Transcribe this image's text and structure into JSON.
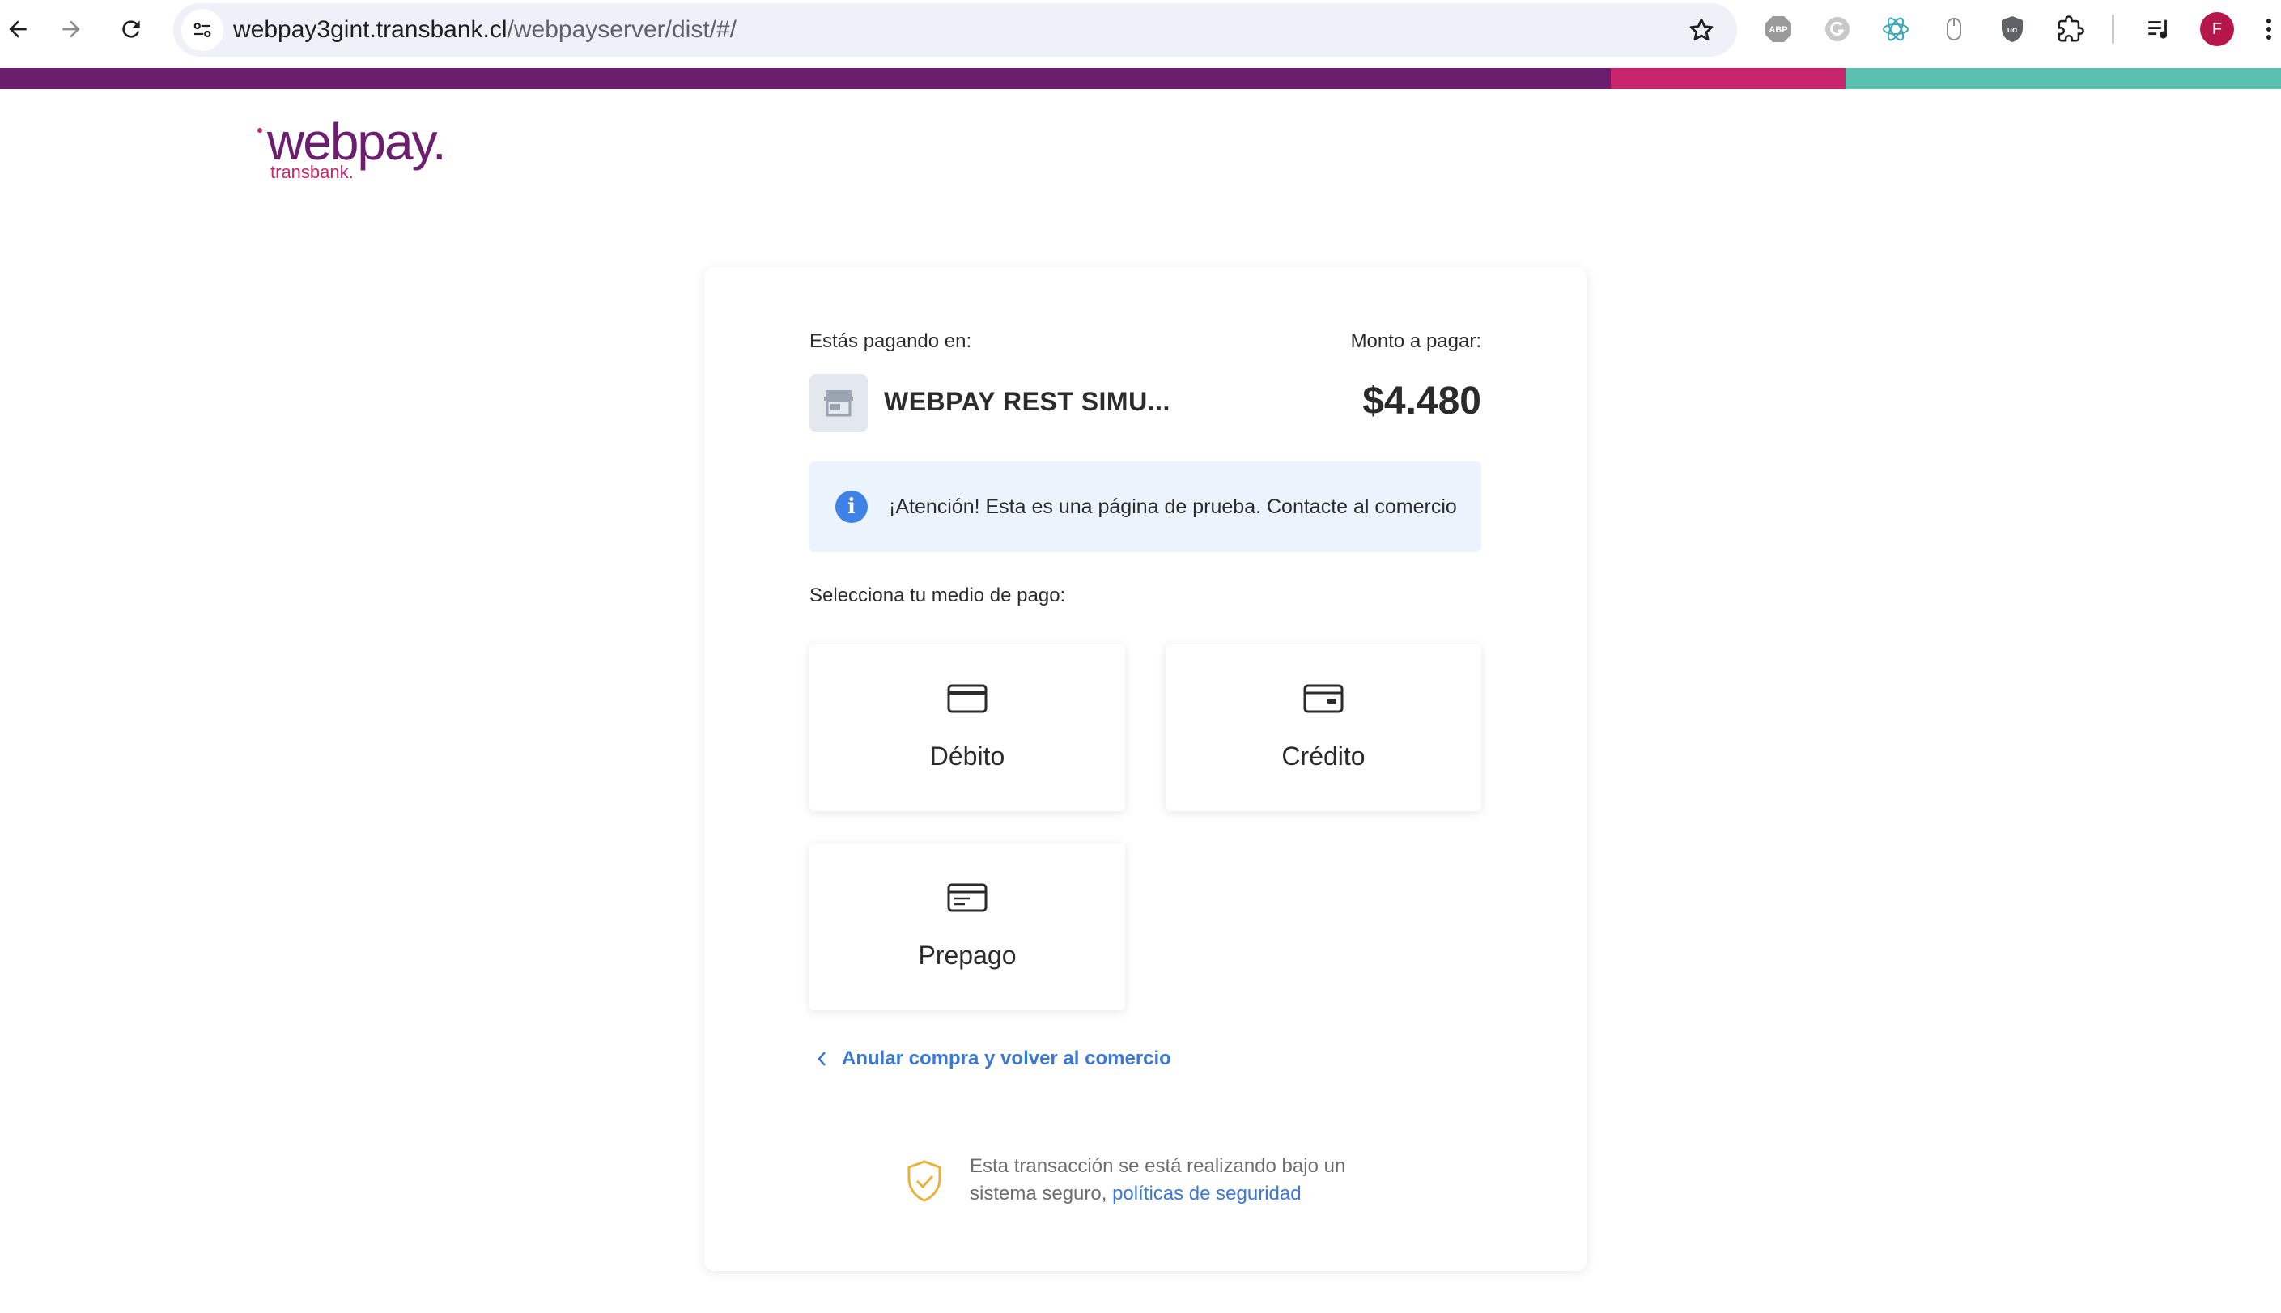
{
  "browser": {
    "url_host": "webpay3gint.transbank.cl",
    "url_path": "/webpayserver/dist/#/",
    "extensions": [
      "adblock-plus-icon",
      "grammar-icon",
      "atom-icon",
      "mouse-icon",
      "ublock-icon",
      "puzzle-extensions-icon"
    ],
    "abp_label": "ABP",
    "profile_initial": "F"
  },
  "colors": {
    "brand_purple": "#6b1e6e",
    "brand_pink": "#c8246c",
    "brand_teal": "#5cc0b0",
    "link_blue": "#3a78d4",
    "alert_bg": "#ebf3fd"
  },
  "logo": {
    "word": "webpay.",
    "sub": "transbank."
  },
  "payment": {
    "paying_label": "Estás pagando en:",
    "amount_label": "Monto a pagar:",
    "merchant_name": "WEBPAY REST SIMU...",
    "amount": "$4.480",
    "alert_text": "¡Atención! Esta es una página de prueba. Contacte al comercio",
    "alert_icon_glyph": "i",
    "select_label": "Selecciona tu medio de pago:",
    "options": [
      {
        "label": "Débito",
        "icon": "debit-card-icon"
      },
      {
        "label": "Crédito",
        "icon": "credit-card-icon"
      },
      {
        "label": "Prepago",
        "icon": "prepaid-card-icon"
      }
    ],
    "cancel_text": "Anular compra y volver al comercio",
    "secure_text_1": "Esta transacción se está realizando bajo un",
    "secure_text_2": "sistema seguro,",
    "secure_link": "políticas de seguridad"
  }
}
